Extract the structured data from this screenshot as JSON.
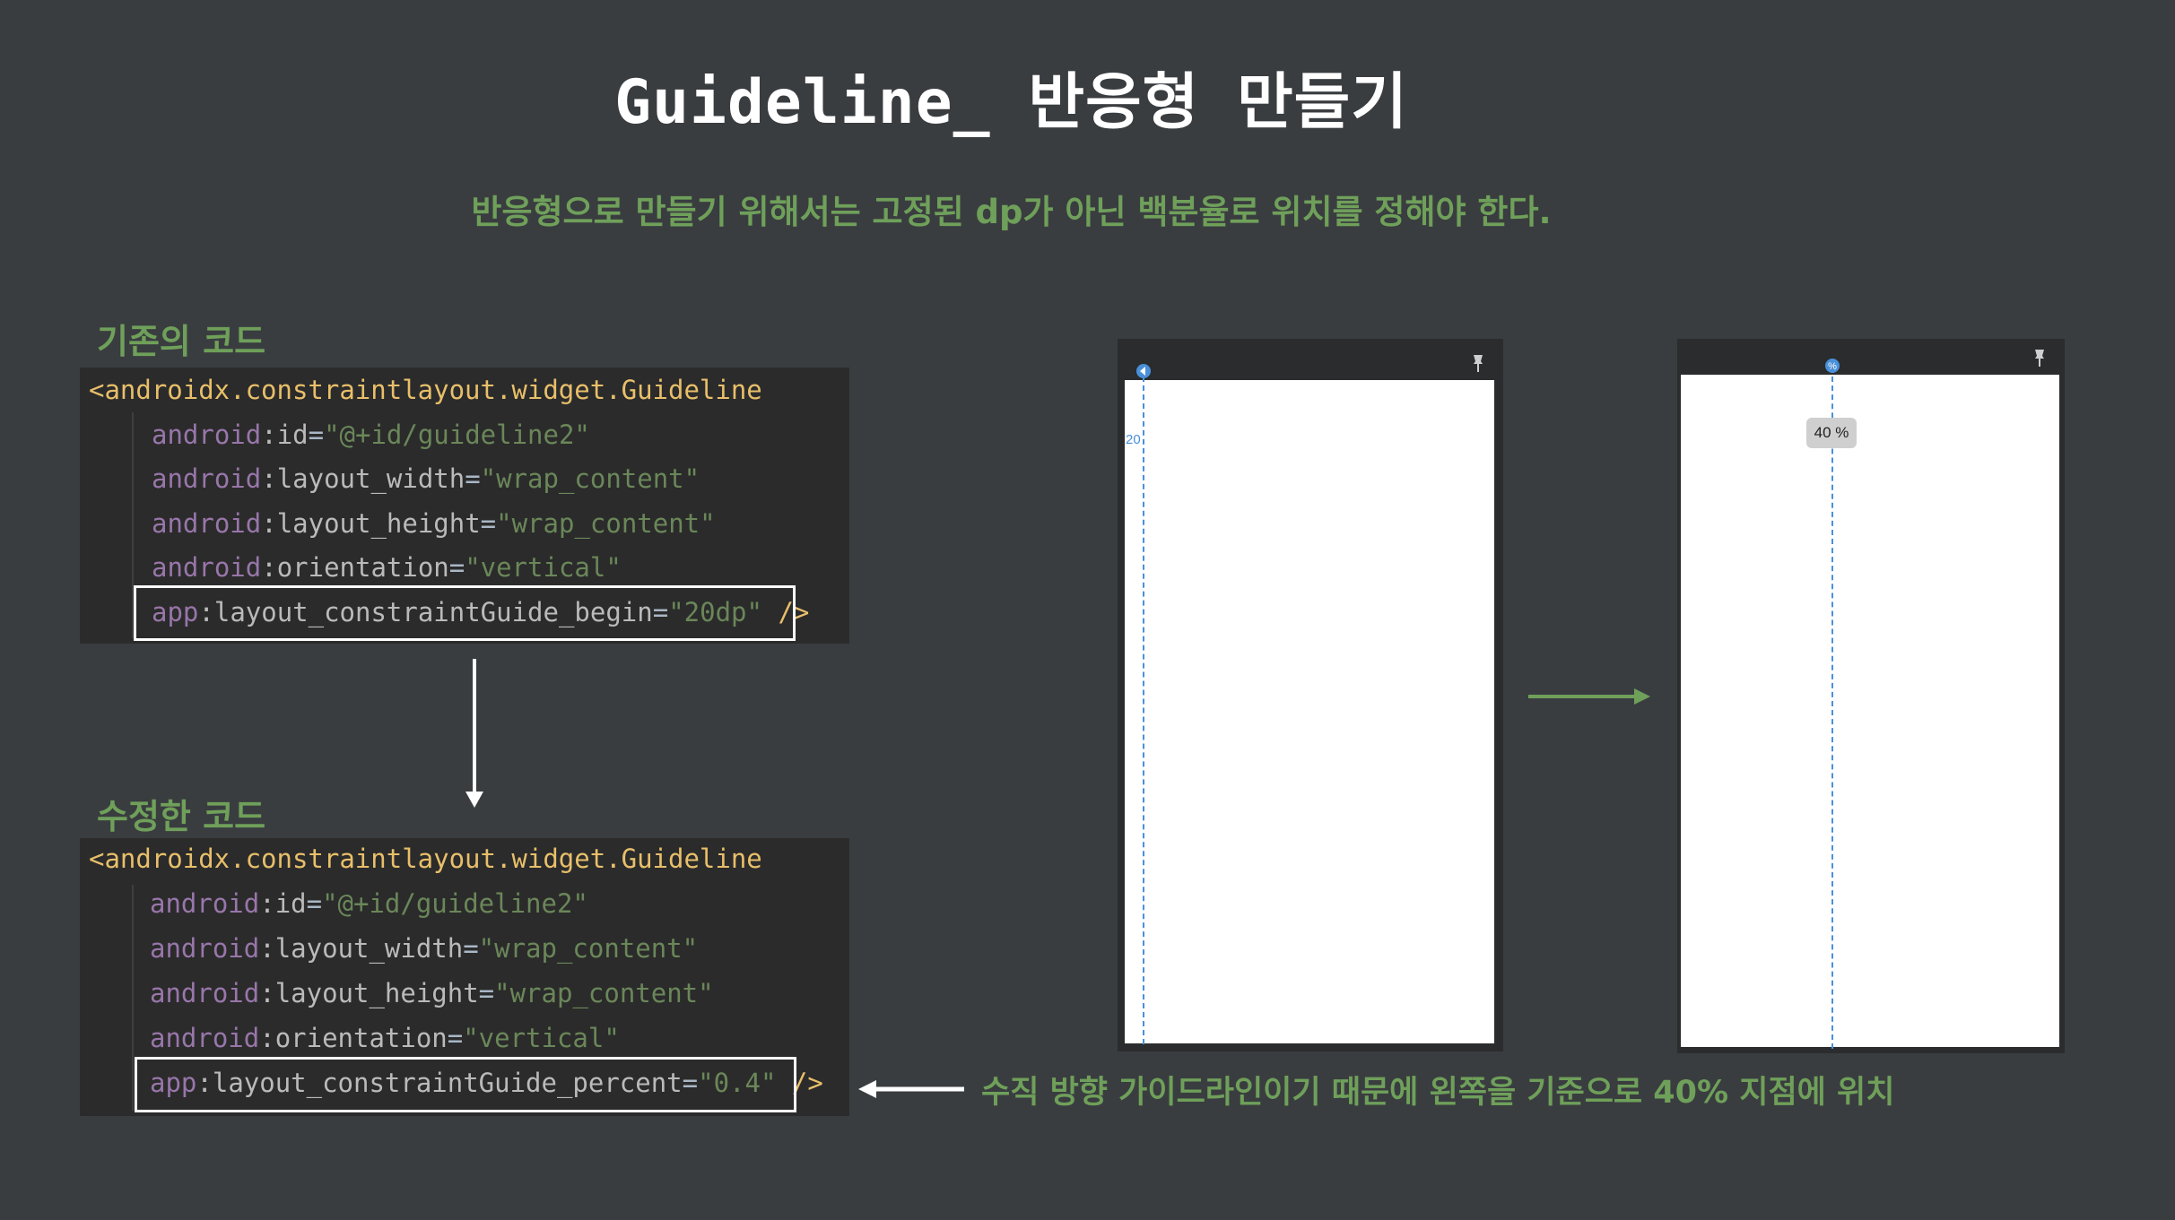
{
  "title": "Guideline_ 반응형 만들기",
  "subtitle": "반응형으로 만들기 위해서는 고정된 dp가 아닌 백분율로 위치를 정해야 한다.",
  "before": {
    "label": "기존의 코드",
    "open_tag": "<androidx.constraintlayout.widget.Guideline",
    "lines": [
      {
        "ns": "android",
        "attr": "id",
        "value": "\"@+id/guideline2\""
      },
      {
        "ns": "android",
        "attr": "layout_width",
        "value": "\"wrap_content\""
      },
      {
        "ns": "android",
        "attr": "layout_height",
        "value": "\"wrap_content\""
      },
      {
        "ns": "android",
        "attr": "orientation",
        "value": "\"vertical\""
      },
      {
        "ns": "app",
        "attr": "layout_constraintGuide_begin",
        "value": "\"20dp\""
      }
    ],
    "close": "/>"
  },
  "after": {
    "label": "수정한 코드",
    "open_tag": "<androidx.constraintlayout.widget.Guideline",
    "lines": [
      {
        "ns": "android",
        "attr": "id",
        "value": "\"@+id/guideline2\""
      },
      {
        "ns": "android",
        "attr": "layout_width",
        "value": "\"wrap_content\""
      },
      {
        "ns": "android",
        "attr": "layout_height",
        "value": "\"wrap_content\""
      },
      {
        "ns": "android",
        "attr": "orientation",
        "value": "\"vertical\""
      },
      {
        "ns": "app",
        "attr": "layout_constraintGuide_percent",
        "value": "\"0.4\""
      }
    ],
    "close": "/>"
  },
  "preview_before": {
    "offset_label": "20"
  },
  "preview_after": {
    "percent_label": "40 %",
    "percent_icon": "%"
  },
  "note": "수직 방향 가이드라인이기 때문에 왼쪽을 기준으로 40% 지점에 위치",
  "icons": {
    "guideline_handle_before": "arrow-circle-icon",
    "guideline_handle_after": "percent-circle-icon",
    "phone_pin": "pin-icon"
  },
  "colors": {
    "background": "#3a3d40",
    "accent_green": "#6fa05a",
    "code_bg": "#2b2b2b",
    "guide_blue": "#4a90d9"
  }
}
